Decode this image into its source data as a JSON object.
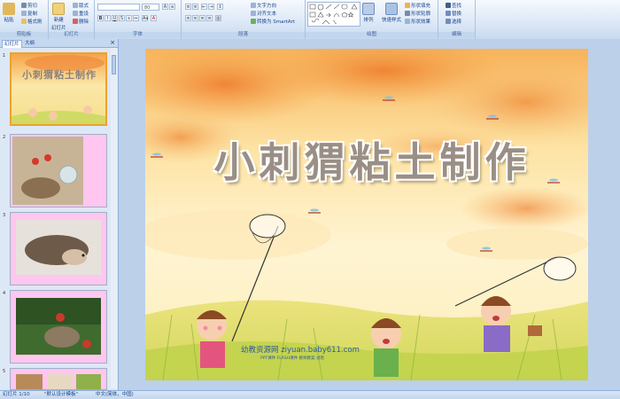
{
  "ribbon": {
    "clipboard": {
      "paste": "粘贴",
      "cut": "剪切",
      "copy": "复制",
      "format_painter": "格式刷",
      "label": "剪贴板"
    },
    "slides": {
      "new_slide": "新建",
      "new_slide_sub": "幻灯片",
      "layout": "版式",
      "reset": "重设",
      "delete": "删除",
      "label": "幻灯片"
    },
    "font": {
      "font_size": "80",
      "label": "字体"
    },
    "paragraph": {
      "text_direction": "文字方向",
      "align_text": "对齐文本",
      "smartart": "转换为 SmartArt",
      "label": "段落"
    },
    "drawing": {
      "arrange": "排列",
      "quick_styles": "快速样式",
      "shape_fill": "形状填充",
      "shape_outline": "形状轮廓",
      "shape_effects": "形状效果",
      "label": "绘图"
    },
    "editing": {
      "find": "查找",
      "replace": "替换",
      "select": "选择",
      "label": "编辑"
    }
  },
  "panel": {
    "tab_slides": "幻灯片",
    "tab_outline": "大纲",
    "close": "×"
  },
  "thumbnails": [
    {
      "num": "1",
      "title": "小刺猬粘土制作"
    },
    {
      "num": "2"
    },
    {
      "num": "3"
    },
    {
      "num": "4"
    },
    {
      "num": "5"
    }
  ],
  "slide": {
    "title": "小刺猬粘土制作",
    "watermark_main": "幼教资源网 ziyuan.baby611.com",
    "watermark_sub": "PPT课件   FLASH课件   教师教案   试卷"
  },
  "status": {
    "slide_info": "幻灯片 1/10",
    "theme": "\"默认设计模板\"",
    "language": "中文(简体，中国)"
  },
  "colors": {
    "ribbon": "#dbe7f6",
    "accent_selected": "#f0a12c",
    "thumb_bg_pink": "#ffc6f0",
    "title_fill": "#9a8f86"
  }
}
